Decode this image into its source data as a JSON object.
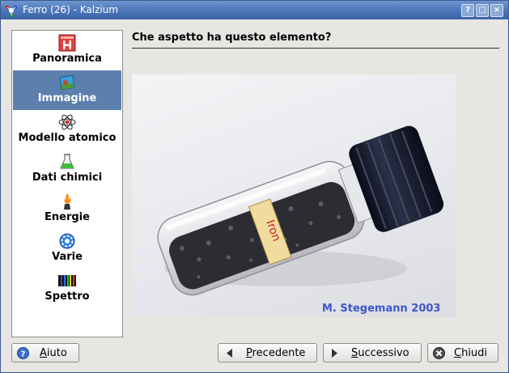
{
  "window": {
    "title": "Ferro (26) - Kalzium",
    "controls": {
      "help": "?",
      "maximize": "□",
      "close": "×"
    }
  },
  "sidebar": {
    "items": [
      {
        "label": "Panoramica",
        "icon": "periodic-element-icon"
      },
      {
        "label": "Immagine",
        "icon": "picture-icon",
        "selected": true
      },
      {
        "label": "Modello atomico",
        "icon": "atom-icon"
      },
      {
        "label": "Dati chimici",
        "icon": "flask-icon"
      },
      {
        "label": "Energie",
        "icon": "flame-icon"
      },
      {
        "label": "Varie",
        "icon": "gear-icon"
      },
      {
        "label": "Spettro",
        "icon": "spectrum-icon"
      }
    ]
  },
  "main": {
    "heading": "Che aspetto ha questo elemento?",
    "image": {
      "vial_label": "Iron",
      "credit": "M. Stegemann 2003"
    }
  },
  "buttons": {
    "help": "Aiuto",
    "previous": "Precedente",
    "next": "Successivo",
    "close": "Chiudi"
  },
  "colors": {
    "titlebar": "#4b75b8",
    "selection": "#5d7fae",
    "credit_text": "#3f57c8"
  }
}
